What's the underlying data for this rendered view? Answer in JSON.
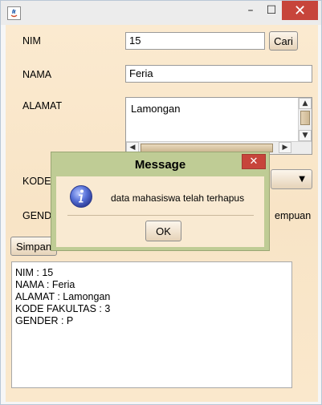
{
  "window": {
    "controls": {
      "minimize": "–",
      "maximize": "☐",
      "close": "✕"
    }
  },
  "form": {
    "nim_label": "NIM",
    "nim_value": "15",
    "cari_label": "Cari",
    "nama_label": "NAMA",
    "nama_value": "Feria",
    "alamat_label": "ALAMAT",
    "alamat_value": "Lamongan",
    "kode_label_visible": "KODE_",
    "gender_label_visible": "GENDE",
    "gender_option_visible": "empuan",
    "simpan_label_visible": "Simpan"
  },
  "output": {
    "lines": [
      "NIM : 15",
      "NAMA : Feria",
      "ALAMAT : Lamongan",
      "KODE FAKULTAS : 3",
      "GENDER : P"
    ]
  },
  "dialog": {
    "title": "Message",
    "close": "✕",
    "message": "data mahasiswa telah terhapus",
    "ok_label": "OK",
    "icon": "info-icon"
  },
  "colors": {
    "panel": "#f8e4c6",
    "dialog_frame": "#bfcc95",
    "close_red": "#c7453b"
  }
}
